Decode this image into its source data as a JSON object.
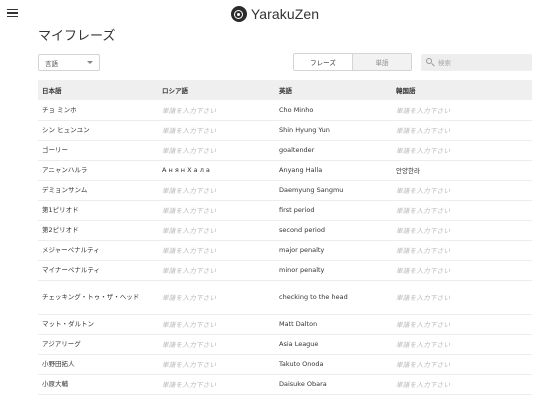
{
  "app": {
    "brand": "YarakuZen"
  },
  "page": {
    "title": "マイフレーズ"
  },
  "filters": {
    "language_select": "言語",
    "toggle": {
      "phrases_label": "フレーズ",
      "words_label": "単語"
    },
    "search_placeholder": "検索"
  },
  "table": {
    "headers": [
      "日本語",
      "ロシア語",
      "英語",
      "韓国語"
    ],
    "placeholder": "単語を入力下さい",
    "rows": [
      {
        "ja": "チョ ミンホ",
        "ru": "",
        "en": "Cho Minho",
        "ko": ""
      },
      {
        "ja": "シン ヒュンユン",
        "ru": "",
        "en": "Shin Hyung Yun",
        "ko": ""
      },
      {
        "ja": "ゴーリー",
        "ru": "",
        "en": "goaltender",
        "ko": ""
      },
      {
        "ja": "アニャンハルラ",
        "ru": "А н я н Х а л а",
        "en": "Anyang Halla",
        "ko": "안양한라"
      },
      {
        "ja": "デミョンサンム",
        "ru": "",
        "en": "Daemyung Sangmu",
        "ko": ""
      },
      {
        "ja": "第1ピリオド",
        "ru": "",
        "en": "first period",
        "ko": ""
      },
      {
        "ja": "第2ピリオド",
        "ru": "",
        "en": "second period",
        "ko": ""
      },
      {
        "ja": "メジャーペナルティ",
        "ru": "",
        "en": "major penalty",
        "ko": ""
      },
      {
        "ja": "マイナーペナルティ",
        "ru": "",
        "en": "minor penalty",
        "ko": ""
      },
      {
        "ja": "チェッキング・トゥ・ザ・ヘッド",
        "ru": "",
        "en": "checking to the head",
        "ko": ""
      },
      {
        "ja": "マット・ダルトン",
        "ru": "",
        "en": "Matt Dalton",
        "ko": ""
      },
      {
        "ja": "アジアリーグ",
        "ru": "",
        "en": "Asia League",
        "ko": ""
      },
      {
        "ja": "小野田拓人",
        "ru": "",
        "en": "Takuto Onoda",
        "ko": ""
      },
      {
        "ja": "小原大輔",
        "ru": "",
        "en": "Daisuke Obara",
        "ko": ""
      }
    ]
  }
}
